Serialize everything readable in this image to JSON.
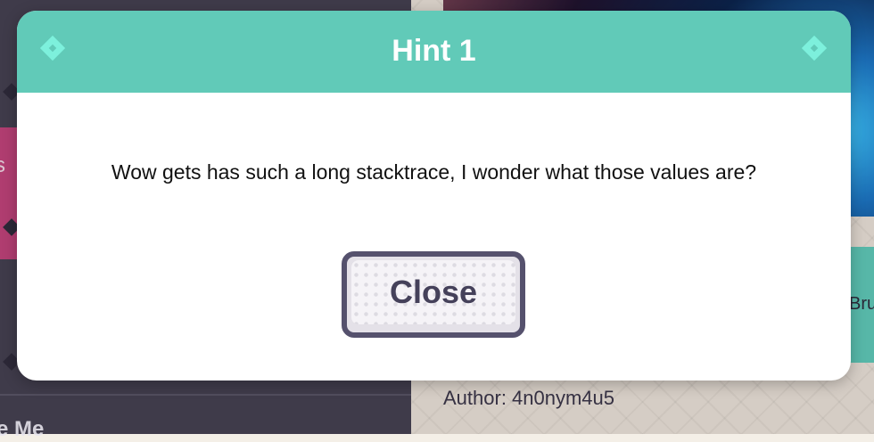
{
  "background": {
    "author_text": "Author: 4n0nym4u5",
    "cut_right_text": "Bru",
    "cut_sidebar_text": "e Me",
    "cut_pink_text": "s"
  },
  "modal": {
    "title": "Hint 1",
    "left_icon": "diamond-icon",
    "right_icon": "diamond-icon",
    "hint_text": "Wow gets has such a long stacktrace, I wonder what those values are?",
    "close_label": "Close",
    "header_color": "#61cab8",
    "button_border_color": "#55516d"
  }
}
